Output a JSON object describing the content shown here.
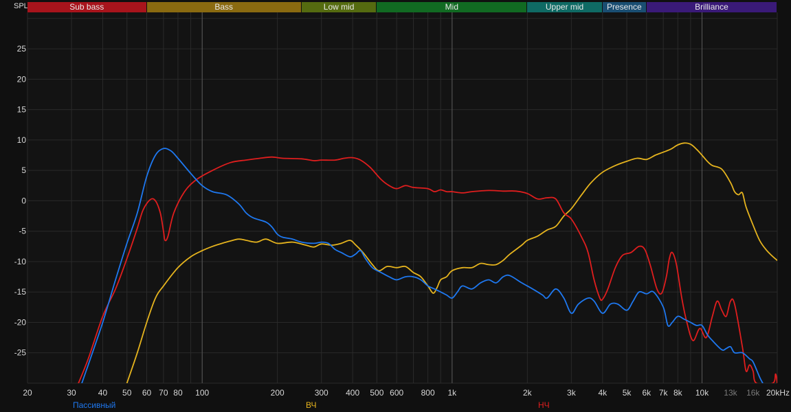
{
  "axis": {
    "y_label": "SPL"
  },
  "bands": [
    {
      "label": "Sub bass",
      "from": 20,
      "to": 60,
      "color": "#a8141c"
    },
    {
      "label": "Bass",
      "from": 60,
      "to": 250,
      "color": "#8a6a10"
    },
    {
      "label": "Low mid",
      "from": 250,
      "to": 500,
      "color": "#556b10"
    },
    {
      "label": "Mid",
      "from": 500,
      "to": 2000,
      "color": "#116a22"
    },
    {
      "label": "Upper mid",
      "from": 2000,
      "to": 4000,
      "color": "#0f6a64"
    },
    {
      "label": "Presence",
      "from": 4000,
      "to": 6000,
      "color": "#1a4e72"
    },
    {
      "label": "Brilliance",
      "from": 6000,
      "to": 20000,
      "color": "#3a1a78"
    }
  ],
  "chart_data": {
    "type": "line",
    "title": "",
    "xlabel": "",
    "ylabel": "SPL",
    "x_scale": "log",
    "xlim": [
      20,
      20000
    ],
    "ylim": [
      -30,
      31
    ],
    "grid": true,
    "legend_position": "bottom",
    "x_ticks": [
      {
        "v": 20,
        "label": "20",
        "dim": false
      },
      {
        "v": 30,
        "label": "30",
        "dim": false
      },
      {
        "v": 40,
        "label": "40",
        "dim": false
      },
      {
        "v": 50,
        "label": "50",
        "dim": false
      },
      {
        "v": 60,
        "label": "60",
        "dim": false
      },
      {
        "v": 70,
        "label": "70",
        "dim": false
      },
      {
        "v": 80,
        "label": "80",
        "dim": false
      },
      {
        "v": 100,
        "label": "100",
        "dim": false
      },
      {
        "v": 200,
        "label": "200",
        "dim": false
      },
      {
        "v": 300,
        "label": "300",
        "dim": false
      },
      {
        "v": 400,
        "label": "400",
        "dim": false
      },
      {
        "v": 500,
        "label": "500",
        "dim": false
      },
      {
        "v": 600,
        "label": "600",
        "dim": false
      },
      {
        "v": 800,
        "label": "800",
        "dim": false
      },
      {
        "v": 1000,
        "label": "1k",
        "dim": false
      },
      {
        "v": 2000,
        "label": "2k",
        "dim": false
      },
      {
        "v": 3000,
        "label": "3k",
        "dim": false
      },
      {
        "v": 4000,
        "label": "4k",
        "dim": false
      },
      {
        "v": 5000,
        "label": "5k",
        "dim": false
      },
      {
        "v": 6000,
        "label": "6k",
        "dim": false
      },
      {
        "v": 7000,
        "label": "7k",
        "dim": false
      },
      {
        "v": 8000,
        "label": "8k",
        "dim": false
      },
      {
        "v": 10000,
        "label": "10k",
        "dim": false
      },
      {
        "v": 13000,
        "label": "13k",
        "dim": true
      },
      {
        "v": 16000,
        "label": "16k",
        "dim": true
      },
      {
        "v": 20000,
        "label": "20kHz",
        "dim": false
      }
    ],
    "y_ticks": [
      25,
      20,
      15,
      10,
      5,
      0,
      -5,
      -10,
      -15,
      -20,
      -25
    ],
    "series": [
      {
        "name": "Пассивный",
        "color": "#1e78f0",
        "points": [
          [
            33,
            -30
          ],
          [
            35,
            -27
          ],
          [
            40,
            -20
          ],
          [
            45,
            -13
          ],
          [
            50,
            -7
          ],
          [
            55,
            -2
          ],
          [
            60,
            4
          ],
          [
            65,
            7.5
          ],
          [
            70,
            8.6
          ],
          [
            75,
            8.2
          ],
          [
            80,
            7
          ],
          [
            90,
            4.5
          ],
          [
            100,
            2.5
          ],
          [
            110,
            1.5
          ],
          [
            125,
            1
          ],
          [
            140,
            -0.5
          ],
          [
            150,
            -2
          ],
          [
            160,
            -2.8
          ],
          [
            180,
            -3.5
          ],
          [
            190,
            -4.3
          ],
          [
            200,
            -5.5
          ],
          [
            210,
            -6
          ],
          [
            230,
            -6.3
          ],
          [
            250,
            -6.8
          ],
          [
            280,
            -7
          ],
          [
            300,
            -6.8
          ],
          [
            320,
            -7
          ],
          [
            340,
            -8
          ],
          [
            360,
            -8.5
          ],
          [
            390,
            -9.2
          ],
          [
            410,
            -8.8
          ],
          [
            430,
            -8.2
          ],
          [
            450,
            -9.5
          ],
          [
            480,
            -11
          ],
          [
            520,
            -11.8
          ],
          [
            560,
            -12.5
          ],
          [
            600,
            -13
          ],
          [
            650,
            -12.5
          ],
          [
            700,
            -12.5
          ],
          [
            750,
            -13
          ],
          [
            800,
            -14
          ],
          [
            850,
            -14.5
          ],
          [
            900,
            -15
          ],
          [
            950,
            -15.5
          ],
          [
            1000,
            -16
          ],
          [
            1050,
            -15
          ],
          [
            1100,
            -14
          ],
          [
            1200,
            -14.5
          ],
          [
            1300,
            -13.5
          ],
          [
            1400,
            -13
          ],
          [
            1500,
            -13.5
          ],
          [
            1600,
            -12.5
          ],
          [
            1700,
            -12.3
          ],
          [
            1900,
            -13.5
          ],
          [
            2100,
            -14.5
          ],
          [
            2300,
            -15.5
          ],
          [
            2400,
            -16
          ],
          [
            2600,
            -14.5
          ],
          [
            2800,
            -16
          ],
          [
            3000,
            -18.5
          ],
          [
            3200,
            -17
          ],
          [
            3500,
            -16
          ],
          [
            3700,
            -16.5
          ],
          [
            4000,
            -18.5
          ],
          [
            4300,
            -17
          ],
          [
            4600,
            -17
          ],
          [
            5000,
            -18
          ],
          [
            5300,
            -16.5
          ],
          [
            5600,
            -15
          ],
          [
            6000,
            -15.3
          ],
          [
            6400,
            -15
          ],
          [
            7000,
            -17.5
          ],
          [
            7300,
            -20.5
          ],
          [
            7600,
            -20
          ],
          [
            8000,
            -19
          ],
          [
            8500,
            -19.5
          ],
          [
            9000,
            -20
          ],
          [
            9500,
            -20.5
          ],
          [
            10000,
            -20.5
          ],
          [
            10500,
            -22
          ],
          [
            11000,
            -23
          ],
          [
            12000,
            -24.5
          ],
          [
            12500,
            -24.3
          ],
          [
            13000,
            -24
          ],
          [
            13500,
            -25
          ],
          [
            14500,
            -25
          ],
          [
            15500,
            -26
          ],
          [
            16000,
            -26.5
          ],
          [
            17000,
            -29
          ],
          [
            17500,
            -30
          ]
        ]
      },
      {
        "name": "ВЧ",
        "color": "#e6b41e",
        "points": [
          [
            50,
            -30
          ],
          [
            55,
            -25
          ],
          [
            60,
            -20
          ],
          [
            65,
            -16
          ],
          [
            70,
            -14
          ],
          [
            80,
            -11
          ],
          [
            90,
            -9.2
          ],
          [
            100,
            -8.2
          ],
          [
            110,
            -7.5
          ],
          [
            120,
            -7
          ],
          [
            130,
            -6.6
          ],
          [
            140,
            -6.3
          ],
          [
            150,
            -6.5
          ],
          [
            165,
            -6.8
          ],
          [
            180,
            -6.3
          ],
          [
            200,
            -7
          ],
          [
            230,
            -6.8
          ],
          [
            260,
            -7.3
          ],
          [
            280,
            -7.6
          ],
          [
            300,
            -7.1
          ],
          [
            330,
            -7.3
          ],
          [
            360,
            -7
          ],
          [
            390,
            -6.5
          ],
          [
            410,
            -7.2
          ],
          [
            440,
            -8.5
          ],
          [
            480,
            -10.5
          ],
          [
            510,
            -11.5
          ],
          [
            550,
            -10.8
          ],
          [
            600,
            -11
          ],
          [
            650,
            -10.8
          ],
          [
            700,
            -11.8
          ],
          [
            750,
            -12.5
          ],
          [
            800,
            -14
          ],
          [
            840,
            -15.2
          ],
          [
            870,
            -14.3
          ],
          [
            900,
            -13
          ],
          [
            950,
            -12.5
          ],
          [
            1000,
            -11.5
          ],
          [
            1100,
            -11
          ],
          [
            1200,
            -11
          ],
          [
            1300,
            -10.3
          ],
          [
            1400,
            -10.5
          ],
          [
            1500,
            -10.5
          ],
          [
            1600,
            -9.8
          ],
          [
            1700,
            -8.8
          ],
          [
            1900,
            -7.3
          ],
          [
            2000,
            -6.5
          ],
          [
            2200,
            -5.8
          ],
          [
            2400,
            -4.8
          ],
          [
            2600,
            -4.2
          ],
          [
            2800,
            -2.5
          ],
          [
            3000,
            -1.3
          ],
          [
            3300,
            1
          ],
          [
            3600,
            3
          ],
          [
            4000,
            4.7
          ],
          [
            4500,
            5.8
          ],
          [
            5000,
            6.5
          ],
          [
            5500,
            7
          ],
          [
            6000,
            6.8
          ],
          [
            6500,
            7.5
          ],
          [
            7000,
            8
          ],
          [
            7500,
            8.5
          ],
          [
            8000,
            9.2
          ],
          [
            8500,
            9.5
          ],
          [
            9000,
            9.3
          ],
          [
            9500,
            8.5
          ],
          [
            10000,
            7.5
          ],
          [
            10500,
            6.5
          ],
          [
            11000,
            5.8
          ],
          [
            12000,
            5.2
          ],
          [
            13000,
            3
          ],
          [
            13500,
            1.5
          ],
          [
            14000,
            1
          ],
          [
            14500,
            1.3
          ],
          [
            15000,
            -1
          ],
          [
            16000,
            -4
          ],
          [
            17000,
            -6.5
          ],
          [
            18000,
            -8
          ],
          [
            19000,
            -9
          ],
          [
            20000,
            -9.8
          ]
        ]
      },
      {
        "name": "НЧ",
        "color": "#e01e1e",
        "points": [
          [
            32,
            -30
          ],
          [
            35,
            -26
          ],
          [
            40,
            -19
          ],
          [
            45,
            -14.5
          ],
          [
            50,
            -9.5
          ],
          [
            55,
            -4.5
          ],
          [
            58,
            -1.5
          ],
          [
            62,
            0.2
          ],
          [
            65,
            0
          ],
          [
            68,
            -2
          ],
          [
            70,
            -5
          ],
          [
            71,
            -6.5
          ],
          [
            73,
            -5.8
          ],
          [
            77,
            -2
          ],
          [
            85,
            1.5
          ],
          [
            95,
            3.5
          ],
          [
            110,
            5
          ],
          [
            130,
            6.3
          ],
          [
            150,
            6.7
          ],
          [
            170,
            7
          ],
          [
            190,
            7.2
          ],
          [
            210,
            7
          ],
          [
            250,
            6.9
          ],
          [
            280,
            6.6
          ],
          [
            300,
            6.7
          ],
          [
            340,
            6.7
          ],
          [
            370,
            7
          ],
          [
            400,
            7.1
          ],
          [
            430,
            6.7
          ],
          [
            470,
            5.5
          ],
          [
            520,
            3.5
          ],
          [
            560,
            2.5
          ],
          [
            600,
            2
          ],
          [
            650,
            2.5
          ],
          [
            700,
            2.2
          ],
          [
            800,
            2
          ],
          [
            850,
            1.5
          ],
          [
            900,
            1.8
          ],
          [
            950,
            1.5
          ],
          [
            1000,
            1.5
          ],
          [
            1100,
            1.3
          ],
          [
            1200,
            1.5
          ],
          [
            1400,
            1.7
          ],
          [
            1600,
            1.6
          ],
          [
            1800,
            1.6
          ],
          [
            2000,
            1.2
          ],
          [
            2200,
            0.3
          ],
          [
            2400,
            0.5
          ],
          [
            2600,
            0.3
          ],
          [
            2800,
            -2
          ],
          [
            3000,
            -3
          ],
          [
            3300,
            -6
          ],
          [
            3500,
            -8.5
          ],
          [
            3700,
            -13
          ],
          [
            3900,
            -16
          ],
          [
            4000,
            -16.2
          ],
          [
            4200,
            -14.5
          ],
          [
            4500,
            -11
          ],
          [
            4800,
            -9
          ],
          [
            5200,
            -8.5
          ],
          [
            5600,
            -7.5
          ],
          [
            5900,
            -8
          ],
          [
            6200,
            -10.5
          ],
          [
            6600,
            -14.5
          ],
          [
            6900,
            -15.2
          ],
          [
            7200,
            -12.5
          ],
          [
            7400,
            -9.5
          ],
          [
            7600,
            -8.5
          ],
          [
            7900,
            -10.5
          ],
          [
            8300,
            -16
          ],
          [
            8700,
            -20
          ],
          [
            9200,
            -23
          ],
          [
            9800,
            -21
          ],
          [
            10400,
            -22.5
          ],
          [
            11000,
            -19
          ],
          [
            11500,
            -16.5
          ],
          [
            12000,
            -18
          ],
          [
            12500,
            -19
          ],
          [
            13000,
            -16.5
          ],
          [
            13500,
            -17
          ],
          [
            14500,
            -24
          ],
          [
            15000,
            -28
          ],
          [
            15500,
            -27
          ],
          [
            16000,
            -28
          ],
          [
            16500,
            -30
          ],
          [
            19200,
            -30
          ],
          [
            19700,
            -28.5
          ],
          [
            20000,
            -30
          ]
        ]
      }
    ]
  }
}
